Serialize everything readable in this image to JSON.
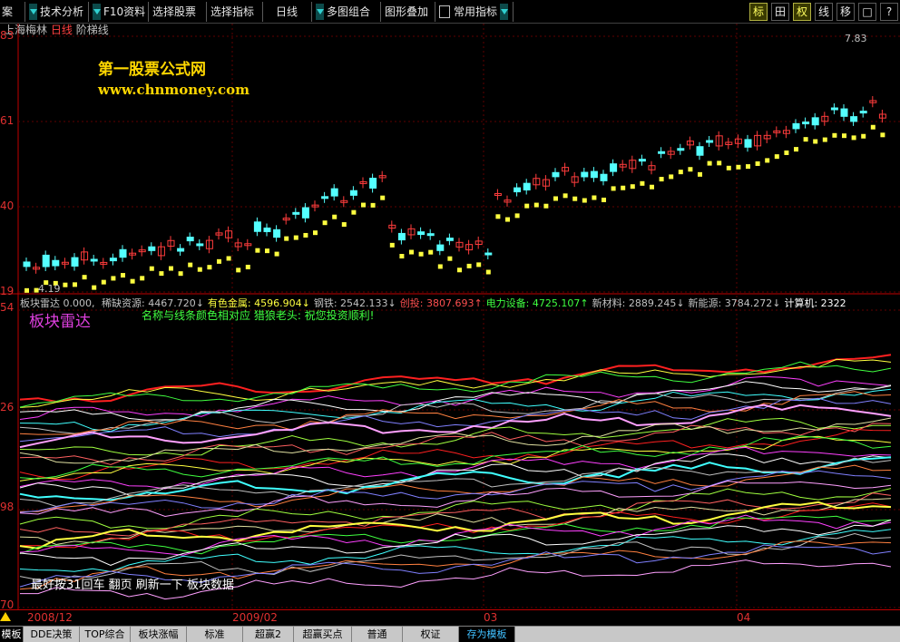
{
  "toolbar": {
    "items": [
      "案",
      "技术分析",
      "F10资料",
      "选择股票",
      "选择指标",
      "日线",
      "多图组合",
      "图形叠加",
      "常用指标"
    ],
    "right_buttons": [
      "标",
      "田",
      "权",
      "线",
      "移",
      "□",
      "?"
    ]
  },
  "main_chart": {
    "stock_name": "上海梅林",
    "period": "日线",
    "indicator": "阶梯线",
    "watermark_title": "第一股票公式网",
    "watermark_url": "www.chnmoney.com",
    "price_high_label": "7.83",
    "price_low_label": "4.19",
    "y_ticks": [
      "83",
      "61",
      "40",
      "19"
    ]
  },
  "radar_panel": {
    "header_name": "板块雷达",
    "header_value": "0.000,",
    "sectors": [
      {
        "name": "稀缺资源:",
        "value": "4467.720",
        "arrow": "↓",
        "color": "#c0c0c0"
      },
      {
        "name": "有色金属:",
        "value": "4596.904",
        "arrow": "↓",
        "color": "#ffff40"
      },
      {
        "name": "钢铁:",
        "value": "2542.133",
        "arrow": "↓",
        "color": "#c0c0c0"
      },
      {
        "name": "创投:",
        "value": "3807.693",
        "arrow": "↑",
        "color": "#ff5050"
      },
      {
        "name": "电力设备:",
        "value": "4725.107",
        "arrow": "↑",
        "color": "#40ff40"
      },
      {
        "name": "新材料:",
        "value": "2889.245",
        "arrow": "↓",
        "color": "#c0c0c0"
      },
      {
        "name": "新能源:",
        "value": "3784.272",
        "arrow": "↓",
        "color": "#c0c0c0"
      },
      {
        "name": "计算机:",
        "value": "2322",
        "arrow": "",
        "color": "#ffffff"
      }
    ],
    "title": "板块雷达",
    "subtitle": "名称与线条颜色相对应   猎狼老头: 祝您投资顺利!",
    "footer_note": "最好按31回车  翻页  刷新一下  板块数据",
    "y_ticks": [
      "54",
      "26",
      "98",
      "70"
    ]
  },
  "x_axis": {
    "labels": [
      "2008/12",
      "2009/02",
      "03",
      "04"
    ]
  },
  "bottom_tabs": [
    "模板",
    "DDE决策",
    "TOP综合",
    "板块涨幅",
    "标准",
    "超赢2",
    "超赢买点",
    "普通",
    "权证",
    "存为模板"
  ],
  "colors": {
    "up": "#ff3c3c",
    "down": "#54ffff",
    "axis": "#c00000",
    "ladder": "#ffff40"
  }
}
